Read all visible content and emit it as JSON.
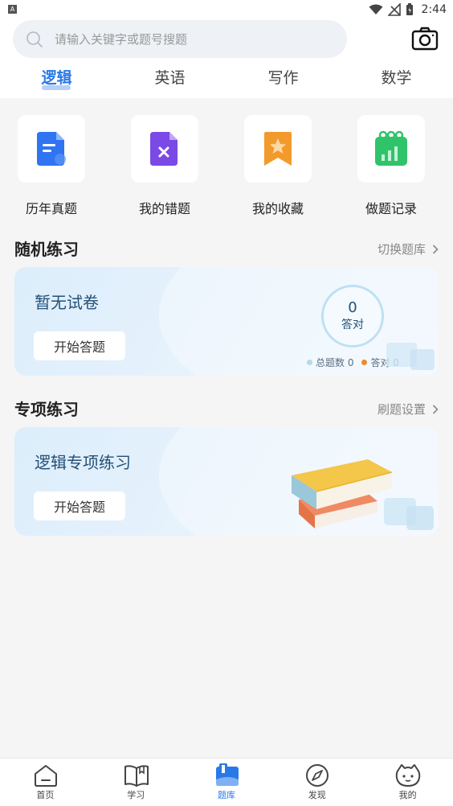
{
  "status": {
    "time": "2:44",
    "app_badge": "A"
  },
  "search": {
    "placeholder": "请输入关键字或题号搜题"
  },
  "tabs": [
    {
      "label": "逻辑",
      "active": true
    },
    {
      "label": "英语",
      "active": false
    },
    {
      "label": "写作",
      "active": false
    },
    {
      "label": "数学",
      "active": false
    }
  ],
  "quick_actions": [
    {
      "label": "历年真题",
      "icon": "document-icon",
      "color": "#2f74f0"
    },
    {
      "label": "我的错题",
      "icon": "wrong-file-icon",
      "color": "#7a49e6"
    },
    {
      "label": "我的收藏",
      "icon": "bookmark-star-icon",
      "color": "#f39a2c"
    },
    {
      "label": "做题记录",
      "icon": "chart-calendar-icon",
      "color": "#2fc46a"
    }
  ],
  "random_practice": {
    "title": "随机练习",
    "switch_label": "切换题库",
    "card_title": "暂无试卷",
    "start_label": "开始答题",
    "correct_count": "0",
    "correct_label": "答对",
    "legend_total": "总题数 0",
    "legend_correct": "答对 0",
    "legend_total_color": "#b8d8ee",
    "legend_correct_color": "#f0892e"
  },
  "special_practice": {
    "title": "专项练习",
    "settings_label": "刷题设置",
    "card_title": "逻辑专项练习",
    "start_label": "开始答题"
  },
  "bottom_nav": [
    {
      "label": "首页",
      "icon": "home-icon",
      "active": false
    },
    {
      "label": "学习",
      "icon": "book-open-icon",
      "active": false
    },
    {
      "label": "题库",
      "icon": "question-bank-icon",
      "active": true
    },
    {
      "label": "发现",
      "icon": "compass-icon",
      "active": false
    },
    {
      "label": "我的",
      "icon": "profile-face-icon",
      "active": false
    }
  ],
  "colors": {
    "accent": "#2a78e8",
    "background": "#f5f5f5"
  }
}
